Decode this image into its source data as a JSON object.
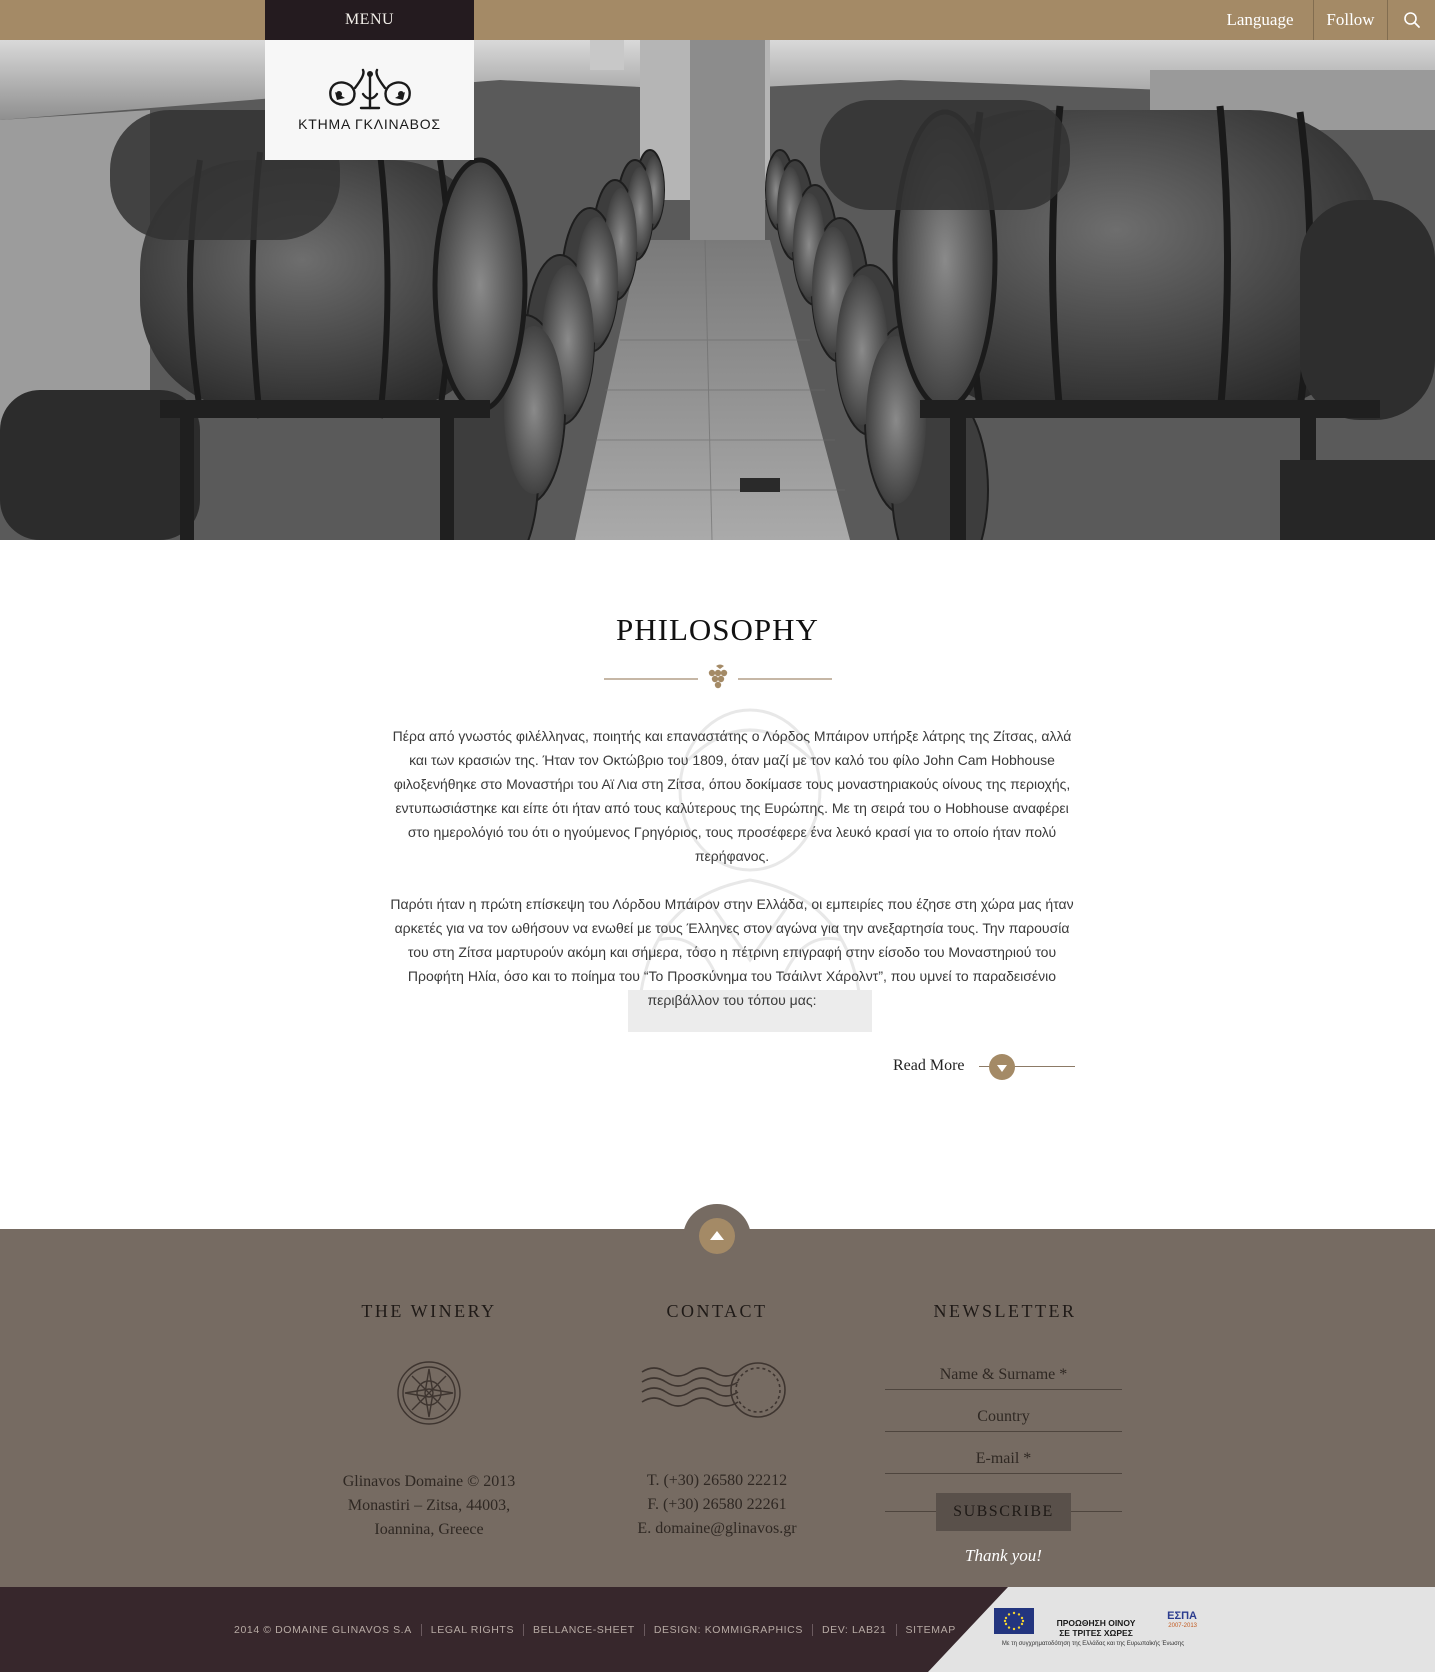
{
  "header": {
    "menu_label": "MENU",
    "nav": {
      "language": "Language",
      "follow": "Follow"
    },
    "search_icon": "search-icon"
  },
  "logo": {
    "text": "ΚΤΗΜΑ ΓΚΛΙΝΑΒΟΣ"
  },
  "philosophy": {
    "title": "PHILOSOPHY",
    "paragraphs": [
      "Πέρα από γνωστός φιλέλληνας, ποιητής και επαναστάτης ο Λόρδος Μπάιρον υπήρξε λάτρης της Ζίτσας, αλλά και των κρασιών της. Ήταν τον Οκτώβριο του 1809, όταν μαζί με τον καλό του φίλο John Cam Hobhouse φιλοξενήθηκε στο Μοναστήρι του Αϊ Λια στη Ζίτσα, όπου δοκίμασε τους μοναστηριακούς οίνους της περιοχής, εντυπωσιάστηκε και είπε ότι ήταν από τους καλύτερους της Ευρώπης. Με τη σειρά του ο Hobhouse αναφέρει στο ημερολόγιό του ότι ο ηγούμενος Γρηγόριος, τους προσέφερε ένα λευκό κρασί για το οποίο ήταν πολύ περήφανος.",
      "Παρότι ήταν η πρώτη επίσκεψη του Λόρδου Μπάιρον στην Ελλάδα, οι εμπειρίες που έζησε στη χώρα μας ήταν αρκετές για να τον ωθήσουν να ενωθεί με τους Έλληνες στον αγώνα για την ανεξαρτησία τους. Την παρουσία του στη Ζίτσα μαρτυρούν ακόμη και σήμερα, τόσο η  πέτρινη επιγραφή στην είσοδο του Μοναστηριού του Προφήτη Ηλία, όσο και το ποίημα του “Το Προσκύνημα του Τσάιλντ Χάρολντ”, που υμνεί το παραδεισένιο περιβάλλον του τόπου μας:"
    ],
    "read_more": "Read More"
  },
  "footer": {
    "winery": {
      "title": "THE WINERY",
      "lines": [
        "Glinavos Domaine © 2013",
        "Monastiri – Zitsa, 44003,",
        "Ioannina, Greece"
      ]
    },
    "contact": {
      "title": "CONTACT",
      "lines": [
        "T. (+30) 26580 22212",
        "F. (+30) 26580 22261",
        "E. domaine@glinavos.gr"
      ]
    },
    "newsletter": {
      "title": "NEWSLETTER",
      "fields": [
        "Name & Surname *",
        "Country",
        "E-mail *"
      ],
      "subscribe": "SUBSCRIBE",
      "thanks": "Thank you!"
    }
  },
  "bottom": {
    "links": [
      "2014 © DOMAINE GLINAVOS S.A",
      "LEGAL RIGHTS",
      "BELLANCE-SHEET",
      "DESIGN: KOMMIGRAPHICS",
      "DEV: LAB21",
      "SITEMAP"
    ],
    "sponsor_title_1": "ΠΡΟΩΘΗΣΗ ΟΙΝΟΥ",
    "sponsor_title_2": "ΣΕ ΤΡΙΤΕΣ ΧΩΡΕΣ",
    "espa": "ΕΣΠΑ",
    "espa_years": "2007-2013",
    "sponsor_footnote": "Με τη συγχρηματοδότηση της Ελλάδας και της Ευρωπαϊκής Ένωσης"
  },
  "colors": {
    "accent": "#a48a66",
    "menu_bg": "#241b1f",
    "footer_bg": "#766b62",
    "bottom_bg": "#37272c"
  }
}
